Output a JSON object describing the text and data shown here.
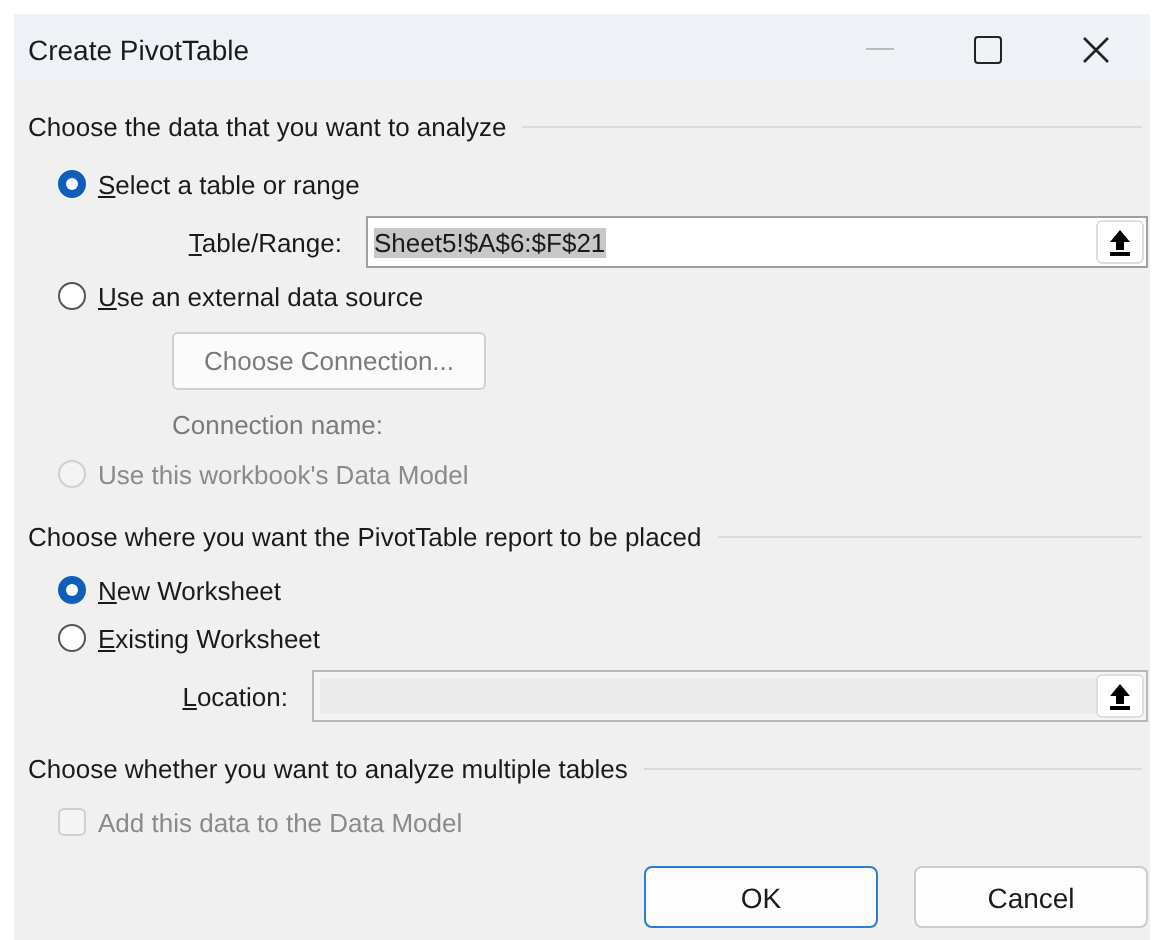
{
  "window": {
    "title": "Create PivotTable"
  },
  "analyze": {
    "heading": "Choose the data that you want to analyze",
    "table_option": {
      "label": "Select a table or range",
      "first_letter_underlined": true,
      "selected": true,
      "disabled": false
    },
    "table_range": {
      "label": "Table/Range:",
      "first_letter_underlined": true,
      "value": "Sheet5!$A$6:$F$21",
      "value_highlighted": true,
      "disabled": false
    },
    "external_option": {
      "label": "Use an external data source",
      "first_letter_underlined": true,
      "selected": false,
      "disabled": false
    },
    "choose_connection_button": {
      "label": "Choose Connection...",
      "disabled": true
    },
    "connection_name_label": "Connection name:",
    "data_model_option": {
      "label": "Use this workbook's Data Model",
      "first_letter_underlined": false,
      "selected": false,
      "disabled": true
    }
  },
  "placement": {
    "heading": "Choose where you want the PivotTable report to be placed",
    "new_option": {
      "label": "New Worksheet",
      "first_letter_underlined": true,
      "selected": true,
      "disabled": false
    },
    "existing_option": {
      "label": "Existing Worksheet",
      "first_letter_underlined": true,
      "selected": false,
      "disabled": false
    },
    "location": {
      "label": "Location:",
      "first_letter_underlined": true,
      "disabled": true
    }
  },
  "multiple": {
    "heading": "Choose whether you want to analyze multiple tables",
    "add_to_model": {
      "label": "Add this data to the Data Model",
      "first_letter_underlined": false,
      "checked": false,
      "disabled": true
    }
  },
  "buttons": [
    {
      "label": "OK",
      "default": true
    },
    {
      "label": "Cancel",
      "default": false
    }
  ]
}
